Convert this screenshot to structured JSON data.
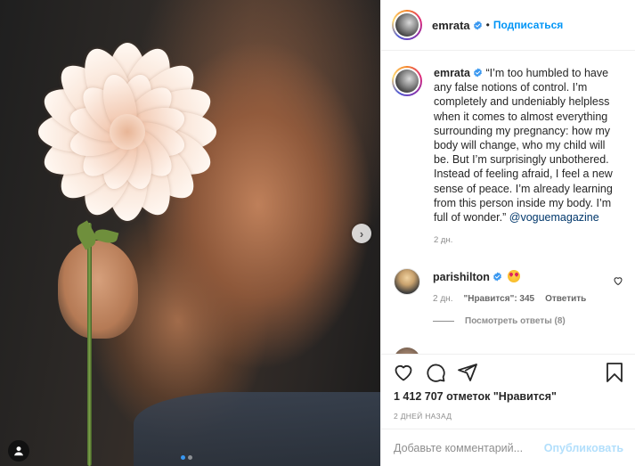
{
  "header": {
    "username": "emrata",
    "separator": "•",
    "follow_label": "Подписаться"
  },
  "caption": {
    "username": "emrata",
    "text": "“I’m too humbled to have any false notions of control. I’m completely and undeniably helpless when it comes to almost everything surrounding my pregnancy: how my body will change, who my child will be. But I’m surprisingly unbothered. Instead of feeling afraid, I feel a new sense of peace. I’m already learning from this person inside my body. I’m full of wonder.” ",
    "mention": "@voguemagazine",
    "time": "2 дн."
  },
  "comment": {
    "username": "parishilton",
    "time": "2 дн.",
    "likes": "\"Нравится\": 345",
    "reply_label": "Ответить",
    "view_replies": "Посмотреть ответы (8)"
  },
  "post": {
    "likes": "1 412 707 отметок \"Нравится\"",
    "date": "2 ДНЕЙ НАЗАД"
  },
  "add_comment": {
    "placeholder": "Добавьте комментарий...",
    "publish_label": "Опубликовать"
  },
  "icons": {
    "like": "heart-icon",
    "comment": "comment-icon",
    "share": "share-icon",
    "save": "bookmark-icon",
    "verified": "verified-badge-icon",
    "next": "chevron-right-icon",
    "tag": "user-tag-icon"
  },
  "colors": {
    "accent": "#0095f6",
    "verified": "#3897f0",
    "muted": "#8e8e8e",
    "publish_disabled": "#b2dffc"
  }
}
